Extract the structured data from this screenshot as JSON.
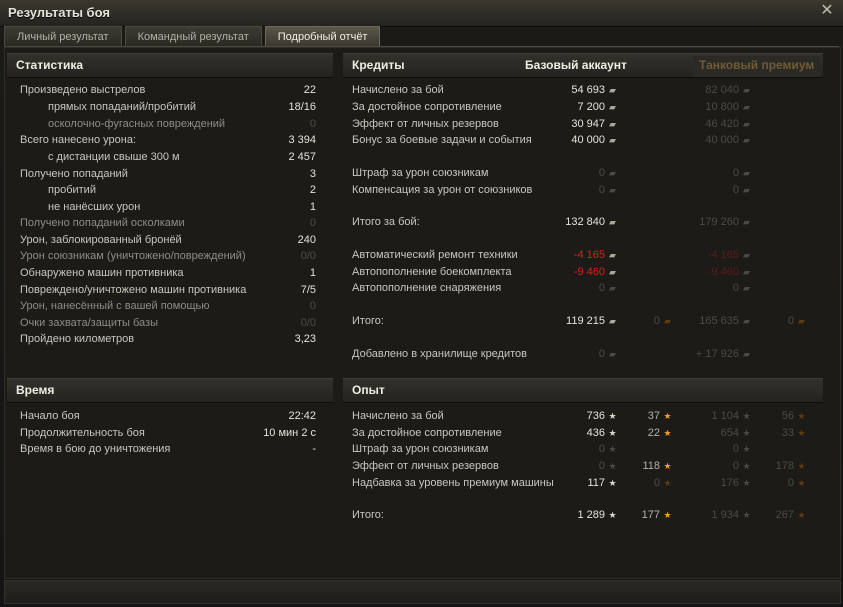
{
  "window": {
    "title": "Результаты боя"
  },
  "tabs": [
    {
      "label": "Личный результат",
      "active": false
    },
    {
      "label": "Командный результат",
      "active": false
    },
    {
      "label": "Подробный отчёт",
      "active": true
    }
  ],
  "stats": {
    "header": "Статистика",
    "rows": [
      {
        "label": "Произведено выстрелов",
        "value": "22",
        "indent": false,
        "dim": false
      },
      {
        "label": "прямых попаданий/пробитий",
        "value": "18/16",
        "indent": true,
        "dim": false
      },
      {
        "label": "осколочно-фугасных повреждений",
        "value": "0",
        "indent": true,
        "dim": true
      },
      {
        "label": "Всего нанесено урона:",
        "value": "3 394",
        "indent": false,
        "dim": false
      },
      {
        "label": "с дистанции свыше 300 м",
        "value": "2 457",
        "indent": true,
        "dim": false
      },
      {
        "label": "Получено попаданий",
        "value": "3",
        "indent": false,
        "dim": false
      },
      {
        "label": "пробитий",
        "value": "2",
        "indent": true,
        "dim": false
      },
      {
        "label": "не нанёсших урон",
        "value": "1",
        "indent": true,
        "dim": false
      },
      {
        "label": "Получено попаданий осколками",
        "value": "0",
        "indent": false,
        "dim": true
      },
      {
        "label": "Урон, заблокированный бронёй",
        "value": "240",
        "indent": false,
        "dim": false
      },
      {
        "label": "Урон союзникам (уничтожено/повреждений)",
        "value": "0/0",
        "indent": false,
        "dim": true
      },
      {
        "label": "Обнаружено машин противника",
        "value": "1",
        "indent": false,
        "dim": false
      },
      {
        "label": "Повреждено/уничтожено машин противника",
        "value": "7/5",
        "indent": false,
        "dim": false
      },
      {
        "label": "Урон, нанесённый с вашей помощью",
        "value": "0",
        "indent": false,
        "dim": true
      },
      {
        "label": "Очки захвата/защиты базы",
        "value": "0/0",
        "indent": false,
        "dim": true
      },
      {
        "label": "Пройдено километров",
        "value": "3,23",
        "indent": false,
        "dim": false
      }
    ]
  },
  "time": {
    "header": "Время",
    "rows": [
      {
        "label": "Начало боя",
        "value": "22:42"
      },
      {
        "label": "Продолжительность боя",
        "value": "10 мин 2 с"
      },
      {
        "label": "Время в бою до уничтожения",
        "value": "-"
      }
    ]
  },
  "credits": {
    "header": "Кредиты",
    "col_base": "Базовый аккаунт",
    "col_premium": "Танковый премиум",
    "rows": [
      {
        "label": "Начислено за бой",
        "base": "54 693",
        "prem": "82 040"
      },
      {
        "label": "За достойное сопротивление",
        "base": "7 200",
        "prem": "10 800"
      },
      {
        "label": "Эффект от личных резервов",
        "base": "30 947",
        "prem": "46 420"
      },
      {
        "label": "Бонус за боевые задачи и события",
        "base": "40 000",
        "prem": "40 000"
      },
      {
        "label": "Штраф за урон союзникам",
        "base": "0",
        "prem": "0"
      },
      {
        "label": "Компенсация за урон от союзников",
        "base": "0",
        "prem": "0"
      },
      {
        "label": "Итого за бой:",
        "base": "132 840",
        "prem": "179 260"
      },
      {
        "label": "Автоматический ремонт техники",
        "base": "-4 165",
        "prem": "-4 165"
      },
      {
        "label": "Автопополнение боекомплекта",
        "base": "-9 460",
        "prem": "-9 460"
      },
      {
        "label": "Автопополнение снаряжения",
        "base": "0",
        "prem": "0"
      },
      {
        "label": "Итого:",
        "base": "119 215",
        "base_gold": "0",
        "prem": "165 635",
        "prem_gold": "0"
      },
      {
        "label": "Добавлено в хранилище кредитов",
        "base": "0",
        "prem": "+ 17 926"
      }
    ]
  },
  "experience": {
    "header": "Опыт",
    "rows": [
      {
        "label": "Начислено за бой",
        "base": "736",
        "base_free": "37",
        "prem": "1 104",
        "prem_free": "56"
      },
      {
        "label": "За достойное сопротивление",
        "base": "436",
        "base_free": "22",
        "prem": "654",
        "prem_free": "33"
      },
      {
        "label": "Штраф за урон союзникам",
        "base": "0",
        "base_free": "",
        "prem": "0",
        "prem_free": ""
      },
      {
        "label": "Эффект от личных резервов",
        "base": "0",
        "base_free": "118",
        "prem": "0",
        "prem_free": "178"
      },
      {
        "label": "Надбавка за уровень премиум машины",
        "base": "117",
        "base_free": "0",
        "prem": "176",
        "prem_free": "0"
      },
      {
        "label": "Итого:",
        "base": "1 289",
        "base_free": "177",
        "prem": "1 934",
        "prem_free": "267"
      }
    ]
  },
  "colors": {
    "negative": "#d3241b",
    "accent_orange": "#f09a2a",
    "premium_header": "#6f5c36"
  }
}
